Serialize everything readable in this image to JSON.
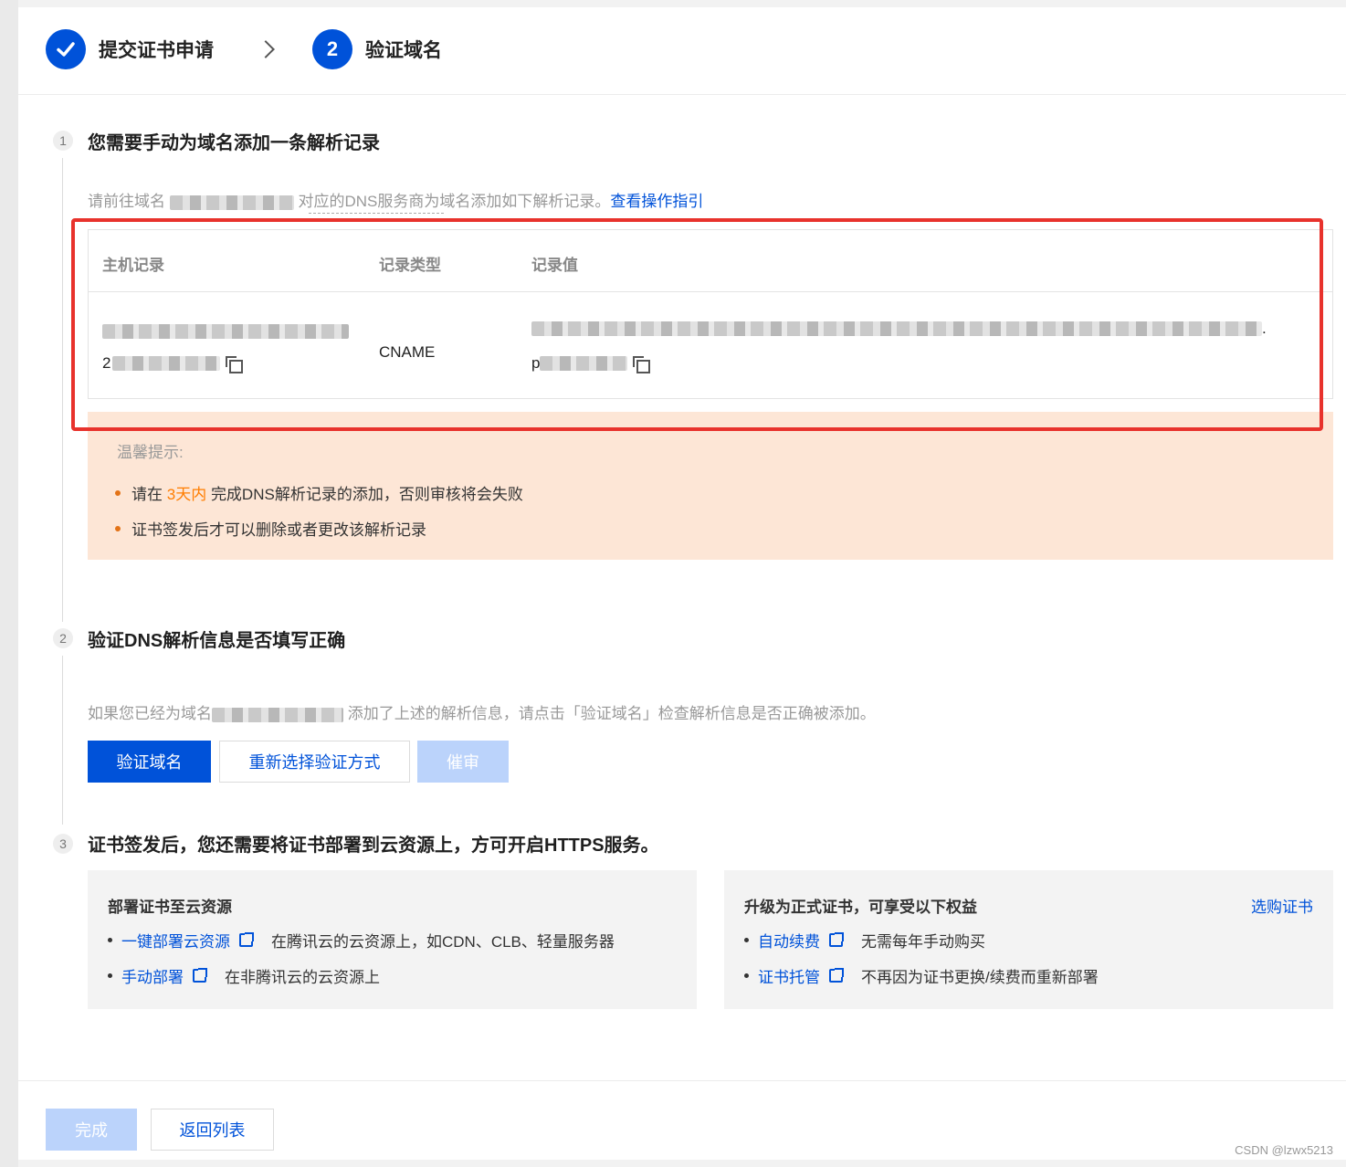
{
  "stepper": {
    "step1_label": "提交证书申请",
    "step2_number": "2",
    "step2_label": "验证域名"
  },
  "section1": {
    "number": "1",
    "title": "您需要手动为域名添加一条解析记录",
    "desc_prefix": "请前往域名",
    "desc_suffix": "对应的DNS服务商为域名添加如下解析记录。",
    "guide_link": "查看操作指引"
  },
  "dns_table": {
    "headers": [
      "主机记录",
      "记录类型",
      "记录值"
    ],
    "row": {
      "host_record_line2_visible": "2",
      "record_type": "CNAME",
      "record_value_line1_tail": ".",
      "record_value_line2_head": "p"
    }
  },
  "tip": {
    "title": "温馨提示:",
    "item1_prefix": "请在",
    "item1_highlight": "3天内",
    "item1_suffix": "完成DNS解析记录的添加，否则审核将会失败",
    "item2": "证书签发后才可以删除或者更改该解析记录"
  },
  "section2": {
    "number": "2",
    "title": "验证DNS解析信息是否填写正确",
    "desc_prefix": "如果您已经为域名",
    "desc_suffix": "添加了上述的解析信息，请点击「验证域名」检查解析信息是否正确被添加。",
    "btn_verify": "验证域名",
    "btn_reselect": "重新选择验证方式",
    "btn_urge": "催审"
  },
  "section3": {
    "number": "3",
    "title": "证书签发后，您还需要将证书部署到云资源上，方可开启HTTPS服务。",
    "card_left": {
      "title": "部署证书至云资源",
      "item1_link": "一键部署云资源",
      "item1_text": "在腾讯云的云资源上，如CDN、CLB、轻量服务器",
      "item2_link": "手动部署",
      "item2_text": "在非腾讯云的云资源上"
    },
    "card_right": {
      "title": "升级为正式证书，可享受以下权益",
      "buy_link": "选购证书",
      "item1_link": "自动续费",
      "item1_text": "无需每年手动购买",
      "item2_link": "证书托管",
      "item2_text": "不再因为证书更换/续费而重新部署"
    }
  },
  "footer": {
    "btn_done": "完成",
    "btn_back": "返回列表"
  },
  "watermark": "CSDN @lzwx5213",
  "colors": {
    "primary": "#0052d9",
    "highlight_border": "#e8322c",
    "tip_bg": "#fde6d6",
    "warning_text": "#ff7d00"
  }
}
